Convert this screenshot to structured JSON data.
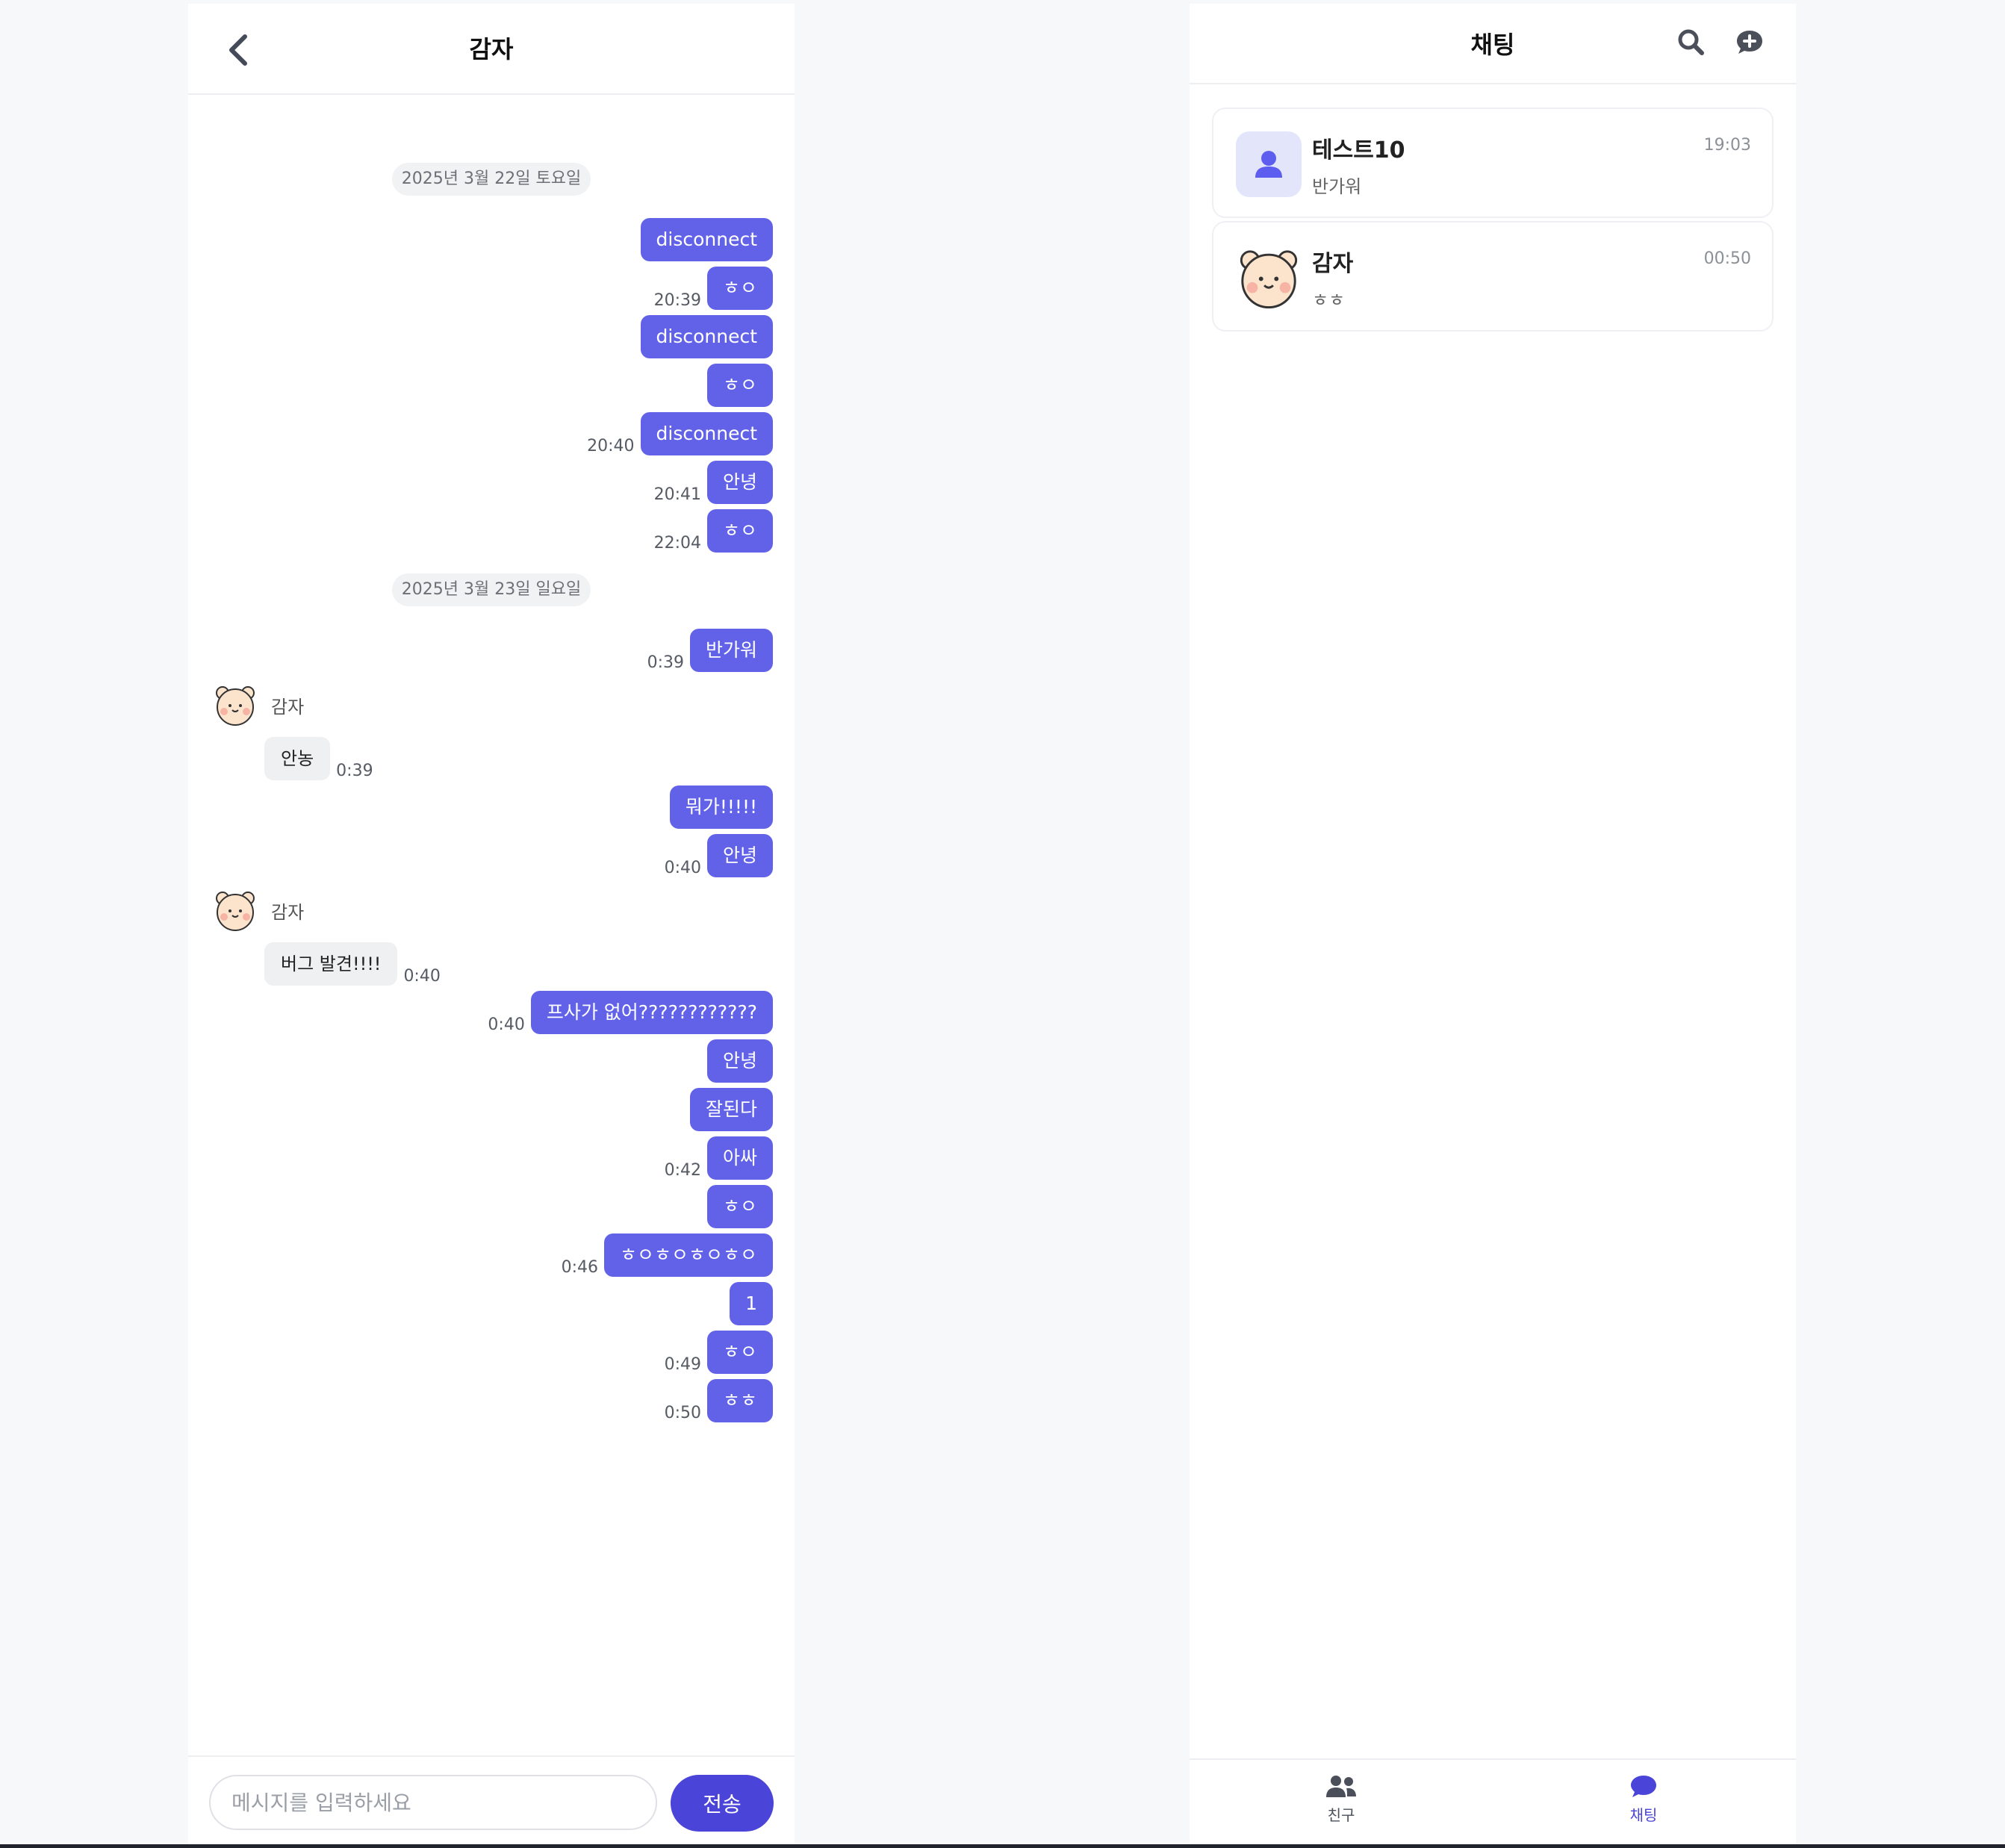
{
  "room": {
    "title": "감자",
    "input_placeholder": "메시지를 입력하세요",
    "send_label": "전송",
    "date_separators": [
      "2025년 3월 22일 토요일",
      "2025년 3월 23일 일요일"
    ],
    "messages_me": [
      {
        "text": "disconnect",
        "time": ""
      },
      {
        "text": "ㅎㅇ",
        "time": "20:39"
      },
      {
        "text": "disconnect",
        "time": ""
      },
      {
        "text": "ㅎㅇ",
        "time": ""
      },
      {
        "text": "disconnect",
        "time": "20:40"
      },
      {
        "text": "안녕",
        "time": "20:41"
      },
      {
        "text": "ㅎㅇ",
        "time": "22:04"
      },
      {
        "text": "반가워",
        "time": "0:39"
      },
      {
        "text": "뭐가!!!!!",
        "time": ""
      },
      {
        "text": "안녕",
        "time": "0:40"
      },
      {
        "text": "프사가 없어????????????",
        "time": "0:40"
      },
      {
        "text": "안녕",
        "time": ""
      },
      {
        "text": "잘된다",
        "time": ""
      },
      {
        "text": "아싸",
        "time": "0:42"
      },
      {
        "text": "ㅎㅇ",
        "time": ""
      },
      {
        "text": "ㅎㅇㅎㅇㅎㅇㅎㅇ",
        "time": "0:46"
      },
      {
        "text": "1",
        "time": ""
      },
      {
        "text": "ㅎㅇ",
        "time": "0:49"
      },
      {
        "text": "ㅎㅎ",
        "time": "0:50"
      }
    ],
    "sender_name": "감자",
    "messages_other": [
      {
        "text": "안농",
        "time": "0:39"
      },
      {
        "text": "버그 발견!!!!",
        "time": "0:40"
      }
    ]
  },
  "list": {
    "title": "채팅",
    "chats": [
      {
        "name": "테스트10",
        "preview": "반가워",
        "time": "19:03",
        "avatar": "default-user-icon"
      },
      {
        "name": "감자",
        "preview": "ㅎㅎ",
        "time": "00:50",
        "avatar": "bear-avatar"
      }
    ],
    "tabs": [
      {
        "label": "친구",
        "icon": "friends-icon",
        "active": false
      },
      {
        "label": "채팅",
        "icon": "chat-bubble-icon",
        "active": true
      }
    ]
  },
  "colors": {
    "accent": "#6262e9",
    "send_button": "#4b44d9",
    "active_tab": "#4b44d9",
    "inactive_tab": "#4a4f5a"
  }
}
